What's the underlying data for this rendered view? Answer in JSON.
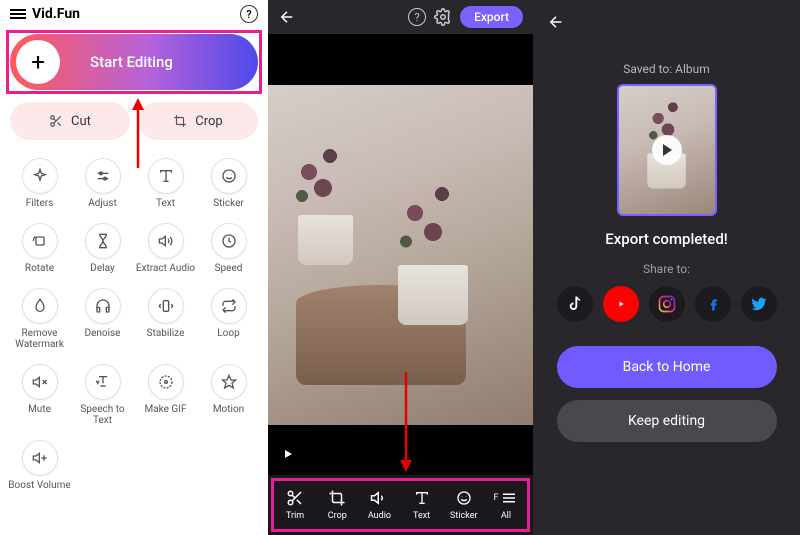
{
  "panel1": {
    "app_name": "Vid.Fun",
    "start_label": "Start Editing",
    "cut_label": "Cut",
    "crop_label": "Crop",
    "tools": [
      {
        "label": "Filters",
        "icon": "sparkle-icon"
      },
      {
        "label": "Adjust",
        "icon": "sliders-icon"
      },
      {
        "label": "Text",
        "icon": "text-icon"
      },
      {
        "label": "Sticker",
        "icon": "smile-icon"
      },
      {
        "label": "Rotate",
        "icon": "rotate-icon"
      },
      {
        "label": "Delay",
        "icon": "hourglass-icon"
      },
      {
        "label": "Extract Audio",
        "icon": "audio-extract-icon"
      },
      {
        "label": "Speed",
        "icon": "speed-icon"
      },
      {
        "label": "Remove Watermark",
        "icon": "drop-icon"
      },
      {
        "label": "Denoise",
        "icon": "headphones-icon"
      },
      {
        "label": "Stabilize",
        "icon": "stabilize-icon"
      },
      {
        "label": "Loop",
        "icon": "loop-icon"
      },
      {
        "label": "Mute",
        "icon": "mute-icon"
      },
      {
        "label": "Speech to Text",
        "icon": "speech-icon"
      },
      {
        "label": "Make GIF",
        "icon": "gif-icon"
      },
      {
        "label": "Motion",
        "icon": "motion-icon"
      },
      {
        "label": "Boost Volume",
        "icon": "boost-icon"
      }
    ]
  },
  "panel2": {
    "export_label": "Export",
    "toolbar": [
      {
        "label": "Trim",
        "icon": "scissors-icon"
      },
      {
        "label": "Crop",
        "icon": "crop-icon"
      },
      {
        "label": "Audio",
        "icon": "audio-icon"
      },
      {
        "label": "Text",
        "icon": "text-icon"
      },
      {
        "label": "Sticker",
        "icon": "smile-icon"
      },
      {
        "label": "All",
        "icon": "menu-icon",
        "prefix": "F"
      }
    ]
  },
  "panel3": {
    "saved_to": "Saved to: Album",
    "completed": "Export completed!",
    "share_label": "Share to:",
    "back_home": "Back to Home",
    "keep_editing": "Keep editing",
    "share_targets": [
      "tiktok",
      "youtube",
      "instagram",
      "facebook",
      "twitter"
    ]
  }
}
